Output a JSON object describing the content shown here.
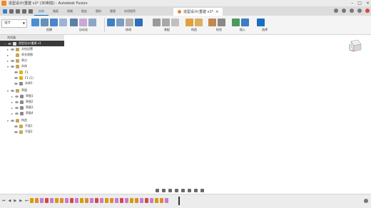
{
  "window": {
    "title": "造型设计(重建 v1* (3D制造) - Autodesk Fusion"
  },
  "ribbon_tabs": [
    {
      "label": "实体",
      "active": true
    },
    {
      "label": "曲面",
      "active": false
    },
    {
      "label": "网格",
      "active": false
    },
    {
      "label": "钣金",
      "active": false
    },
    {
      "label": "塑料",
      "active": false
    },
    {
      "label": "管理",
      "active": false
    },
    {
      "label": "实用程序",
      "active": false
    }
  ],
  "document_tab": {
    "label": "造型设计(重建 v1*"
  },
  "toolbar": {
    "workspace": "设计",
    "groups": [
      {
        "label": "创建"
      },
      {
        "label": "自动化"
      },
      {
        "label": "修改"
      },
      {
        "label": "装配"
      },
      {
        "label": "构造"
      },
      {
        "label": "检验"
      },
      {
        "label": "插入"
      },
      {
        "label": "选择"
      }
    ]
  },
  "browser": {
    "header": "浏览器",
    "rows": [
      {
        "label": "造型设计(重建 v1",
        "depth": 0,
        "kind": "root"
      },
      {
        "label": "文档设置",
        "depth": 1,
        "kind": "folder"
      },
      {
        "label": "命名视图",
        "depth": 1,
        "kind": "folder"
      },
      {
        "label": "原点",
        "depth": 1,
        "kind": "folder"
      },
      {
        "label": "实体",
        "depth": 1,
        "kind": "folder"
      },
      {
        "label": "F1",
        "depth": 2,
        "kind": "body"
      },
      {
        "label": "F1 (1)",
        "depth": 2,
        "kind": "body"
      },
      {
        "label": "实体5",
        "depth": 2,
        "kind": "body"
      },
      {
        "label": "草图",
        "depth": 1,
        "kind": "folder"
      },
      {
        "label": "草图1",
        "depth": 2,
        "kind": "comp"
      },
      {
        "label": "草图2",
        "depth": 2,
        "kind": "comp"
      },
      {
        "label": "草图3",
        "depth": 2,
        "kind": "comp"
      },
      {
        "label": "草图4",
        "depth": 2,
        "kind": "comp"
      },
      {
        "label": "构造",
        "depth": 1,
        "kind": "folder"
      },
      {
        "label": "平面1",
        "depth": 2,
        "kind": "comp"
      },
      {
        "label": "平面2",
        "depth": 2,
        "kind": "comp"
      }
    ]
  },
  "colors": {
    "accent": "#0a6ebd",
    "mesh_body": "#e9e6a2",
    "solid_body": "#bfb4a2"
  }
}
